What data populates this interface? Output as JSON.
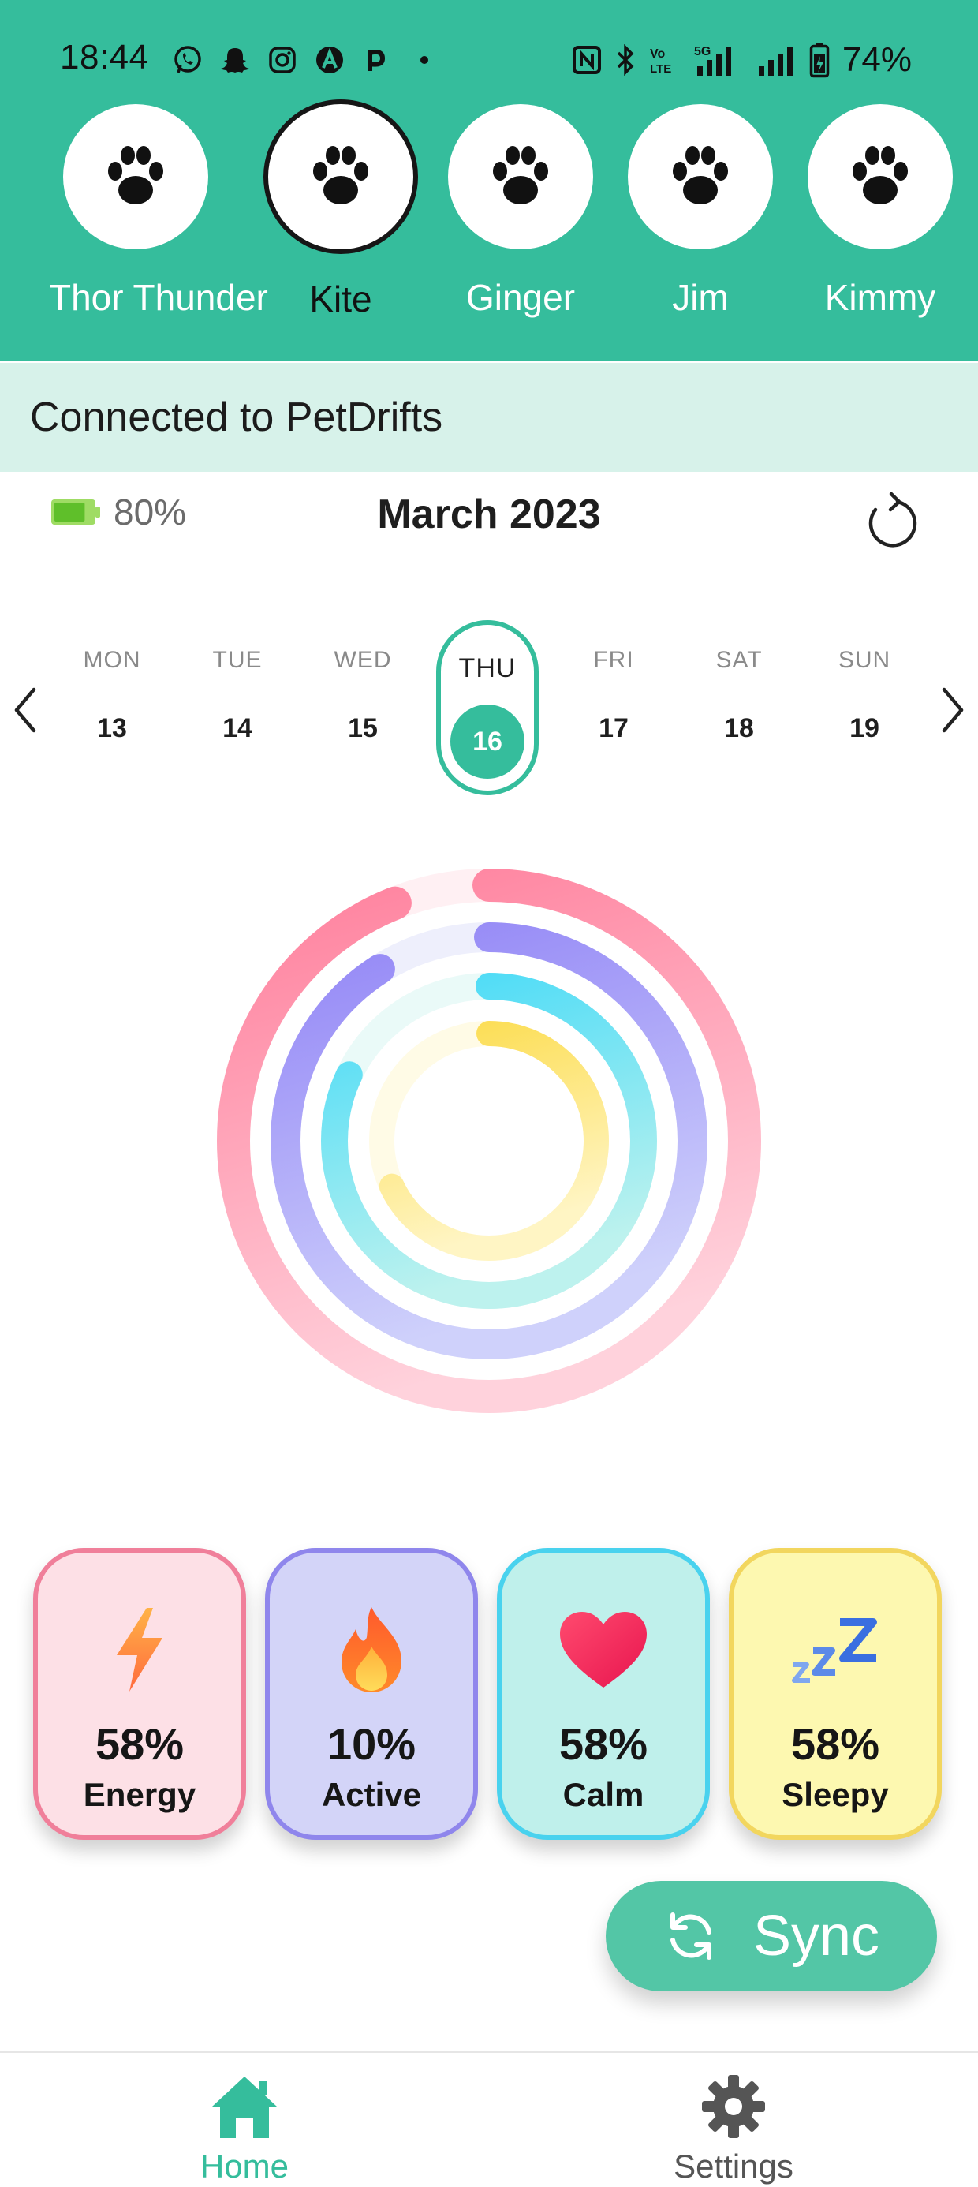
{
  "status_bar": {
    "time": "18:44",
    "battery": "74%",
    "notification_icons": [
      "whatsapp-icon",
      "snapchat-icon",
      "instagram-icon",
      "app-a-icon",
      "app-p-icon",
      "more-dot-icon"
    ],
    "system_icons": [
      "nfc-icon",
      "bluetooth-icon",
      "volte-icon",
      "5g-signal-icon",
      "signal-icon",
      "battery-charging-icon"
    ]
  },
  "pets": [
    {
      "name": "Thor Thunder",
      "icon": "paw-icon",
      "selected": false
    },
    {
      "name": "Kite",
      "icon": "paw-icon",
      "selected": true
    },
    {
      "name": "Ginger",
      "icon": "paw-icon",
      "selected": false
    },
    {
      "name": "Jim",
      "icon": "paw-icon",
      "selected": false
    },
    {
      "name": "Kimmy",
      "icon": "paw-icon",
      "selected": false
    }
  ],
  "connection": {
    "text": "Connected to PetDrifts"
  },
  "device_battery": {
    "percent": "80%",
    "level": 0.8
  },
  "calendar": {
    "month_title": "March 2023",
    "days": [
      {
        "name": "MON",
        "num": "13"
      },
      {
        "name": "TUE",
        "num": "14"
      },
      {
        "name": "WED",
        "num": "15"
      },
      {
        "name": "THU",
        "num": "16",
        "selected": true
      },
      {
        "name": "FRI",
        "num": "17"
      },
      {
        "name": "SAT",
        "num": "18"
      },
      {
        "name": "SUN",
        "num": "19"
      }
    ]
  },
  "stats": [
    {
      "percent": "58%",
      "label": "Energy",
      "icon": "lightning-icon",
      "card_bg": "#fde0e6",
      "border": "#f07f9a"
    },
    {
      "percent": "10%",
      "label": "Active",
      "icon": "flame-icon",
      "card_bg": "#d3d4f8",
      "border": "#8f86ec"
    },
    {
      "percent": "58%",
      "label": "Calm",
      "icon": "heart-icon",
      "card_bg": "#bff0eb",
      "border": "#49d2ee"
    },
    {
      "percent": "58%",
      "label": "Sleepy",
      "icon": "zzz-icon",
      "card_bg": "#fdf8b0",
      "border": "#f2d65e"
    }
  ],
  "rings": [
    {
      "name": "Energy",
      "fraction": 0.94,
      "color": "#ff7f9c",
      "light": "#ffd2dc",
      "track": "#fff0f3"
    },
    {
      "name": "Active",
      "fraction": 0.91,
      "color": "#9285f6",
      "light": "#cfd1fb",
      "track": "#eeeffc"
    },
    {
      "name": "Calm",
      "fraction": 0.82,
      "color": "#45daf7",
      "light": "#bdf2ee",
      "track": "#eafaf8"
    },
    {
      "name": "Sleepy",
      "fraction": 0.68,
      "color": "#fcdc4d",
      "light": "#fff5c4",
      "track": "#fffbe6"
    }
  ],
  "sync": {
    "label": "Sync",
    "icon": "sync-icon"
  },
  "bottom_nav": [
    {
      "label": "Home",
      "icon": "home-icon",
      "active": true
    },
    {
      "label": "Settings",
      "icon": "gear-icon",
      "active": false
    }
  ],
  "colors": {
    "brand": "#35bd9c",
    "banner_bg": "#d7f2ea",
    "inactive": "#555555"
  }
}
